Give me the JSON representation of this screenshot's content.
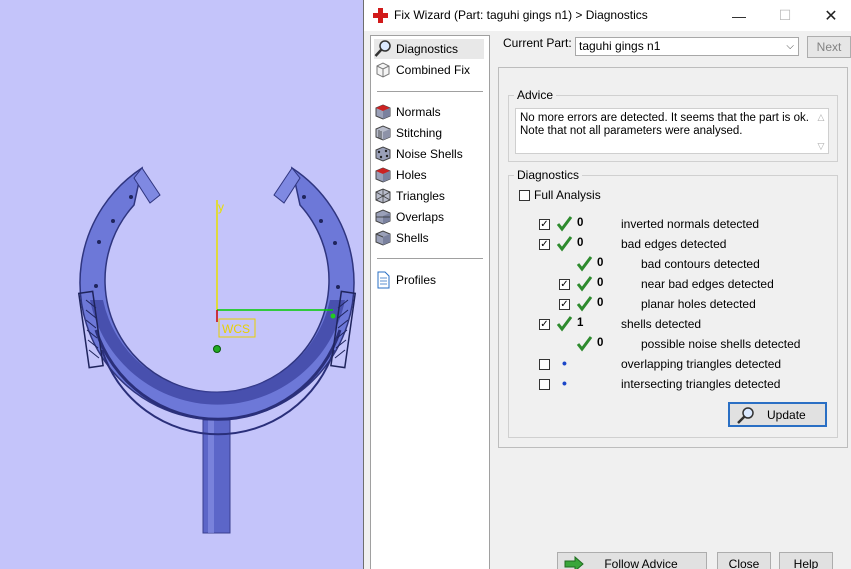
{
  "window": {
    "title": "Fix Wizard (Part: taguhi gings n1) > Diagnostics",
    "minimize_glyph": "—",
    "maximize_glyph": "☐",
    "close_glyph": "✕"
  },
  "viewport": {
    "axis_y_label": "y",
    "wcs_label": "WCS"
  },
  "nav": {
    "items": [
      {
        "label": "Diagnostics",
        "icon": "magnifier-icon"
      },
      {
        "label": "Combined Fix",
        "icon": "cube-outline-icon"
      },
      {
        "label": "Normals",
        "icon": "normals-cube-icon"
      },
      {
        "label": "Stitching",
        "icon": "stitching-icon"
      },
      {
        "label": "Noise Shells",
        "icon": "noise-shells-icon"
      },
      {
        "label": "Holes",
        "icon": "holes-cube-icon"
      },
      {
        "label": "Triangles",
        "icon": "triangles-icon"
      },
      {
        "label": "Overlaps",
        "icon": "overlaps-icon"
      },
      {
        "label": "Shells",
        "icon": "shells-icon"
      },
      {
        "label": "Profiles",
        "icon": "document-icon"
      }
    ]
  },
  "current_part": {
    "label": "Current Part:",
    "value": "taguhi gings n1",
    "next_label": "Next"
  },
  "advice": {
    "title": "Advice",
    "text_line1": "No more errors are detected. It seems that the part is ok.",
    "text_line2": "Note that not all parameters were analysed."
  },
  "diagnostics": {
    "title": "Diagnostics",
    "full_analysis_label": "Full Analysis",
    "rows": [
      {
        "count": "0",
        "label": "inverted normals detected"
      },
      {
        "count": "0",
        "label": "bad edges detected"
      },
      {
        "count": "0",
        "label": "bad contours detected"
      },
      {
        "count": "0",
        "label": "near bad edges detected"
      },
      {
        "count": "0",
        "label": "planar holes detected"
      },
      {
        "count": "1",
        "label": "shells detected"
      },
      {
        "count": "0",
        "label": "possible noise shells detected"
      },
      {
        "count": "",
        "label": "overlapping triangles detected"
      },
      {
        "count": "",
        "label": "intersecting triangles detected"
      }
    ],
    "update_label": "Update"
  },
  "footer": {
    "follow_advice_label": "Follow Advice",
    "close_label": "Close",
    "help_label": "Help"
  },
  "colors": {
    "viewport_bg": "#c4c4fa",
    "part_blue": "#6d78d8",
    "check_green": "#2e8b2e",
    "dot_blue": "#1a46c8",
    "button_focus": "#2a6fc4"
  }
}
